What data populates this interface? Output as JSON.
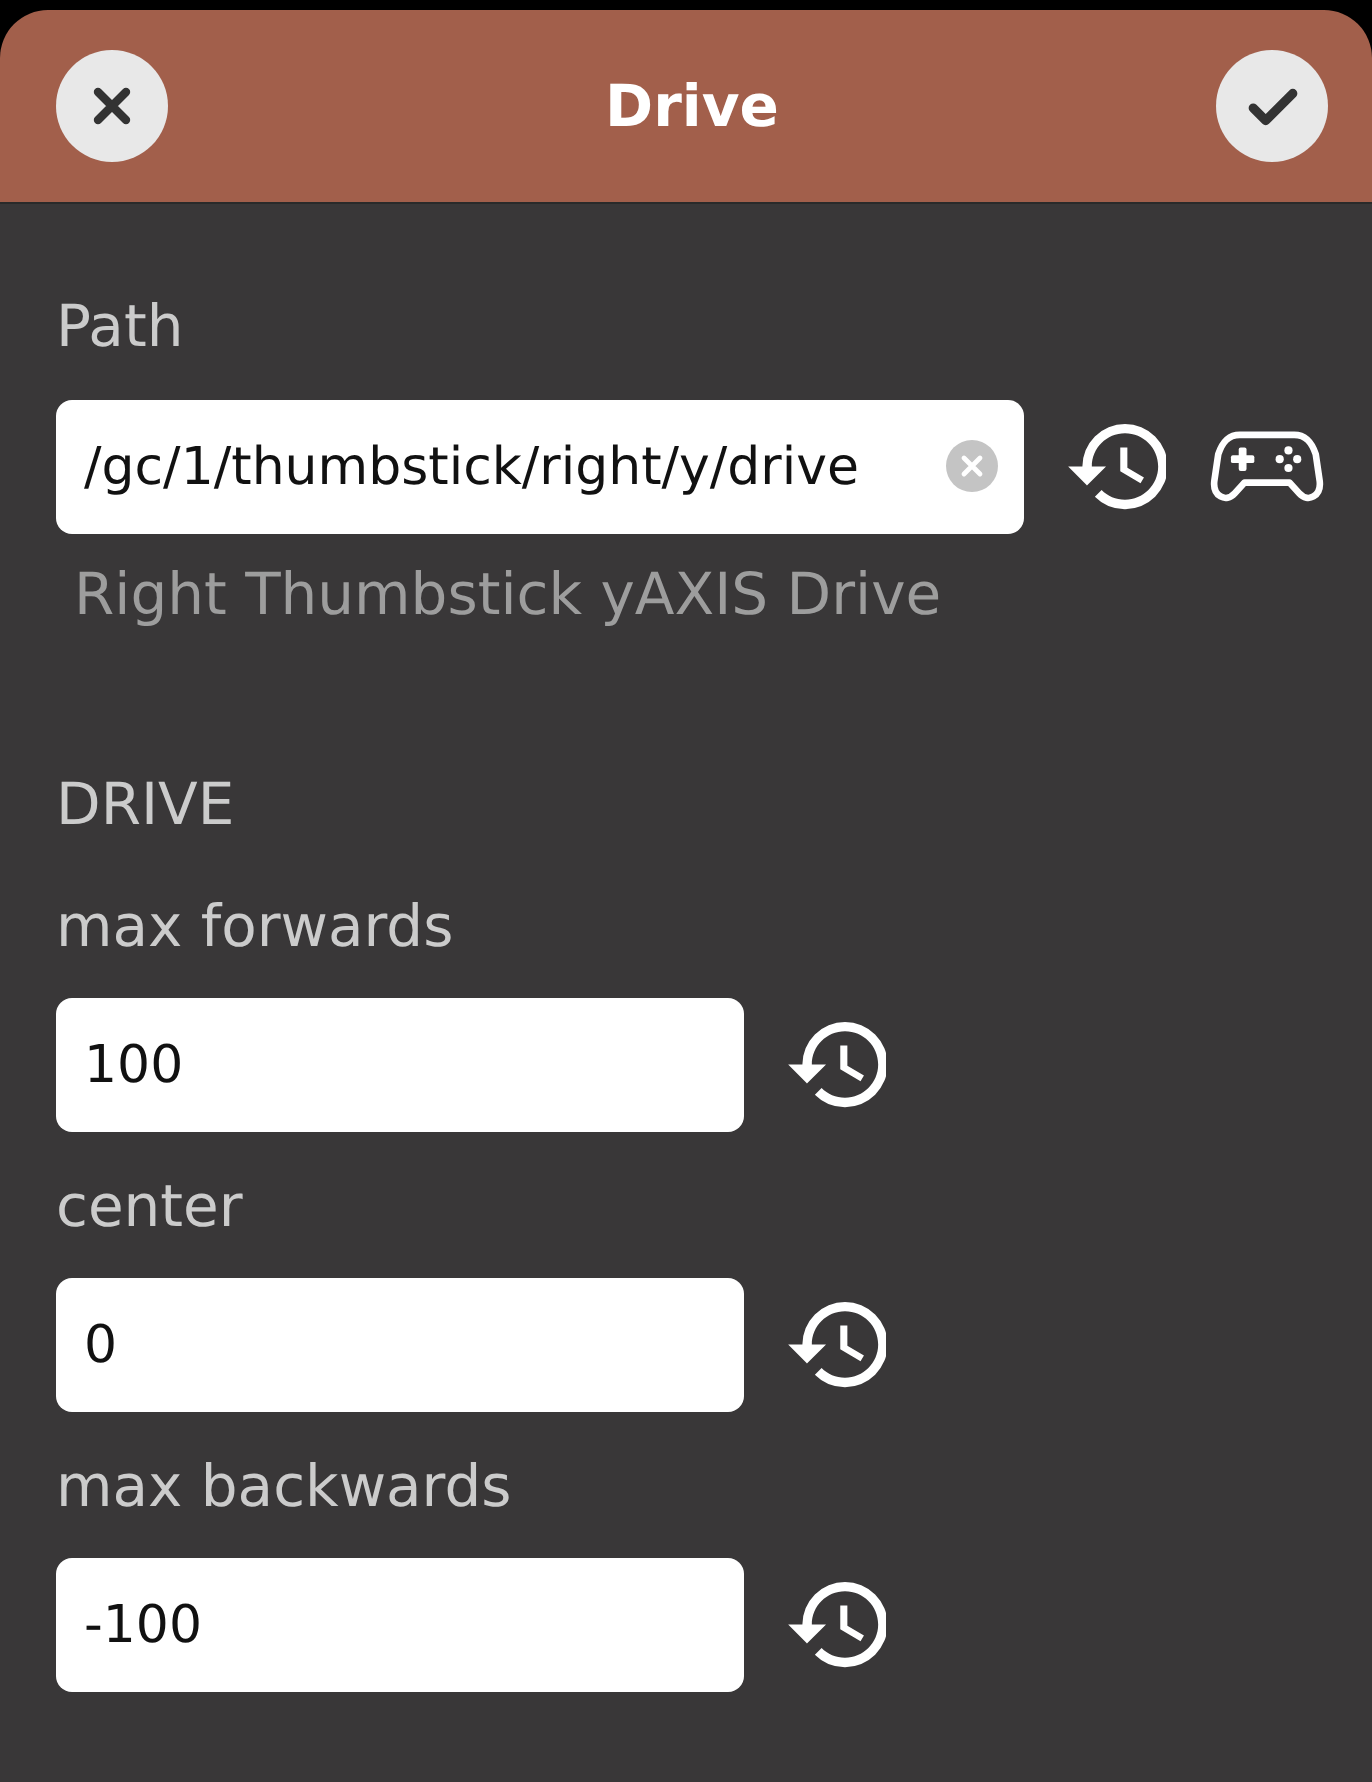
{
  "header": {
    "title": "Drive"
  },
  "path": {
    "label": "Path",
    "value": "/gc/1/thumbstick/right/y/drive",
    "description": "Right Thumbstick yAXIS Drive"
  },
  "section": {
    "title": "DRIVE",
    "fields": [
      {
        "label": "max forwards",
        "value": "100"
      },
      {
        "label": "center",
        "value": "0"
      },
      {
        "label": "max backwards",
        "value": "-100"
      }
    ]
  }
}
